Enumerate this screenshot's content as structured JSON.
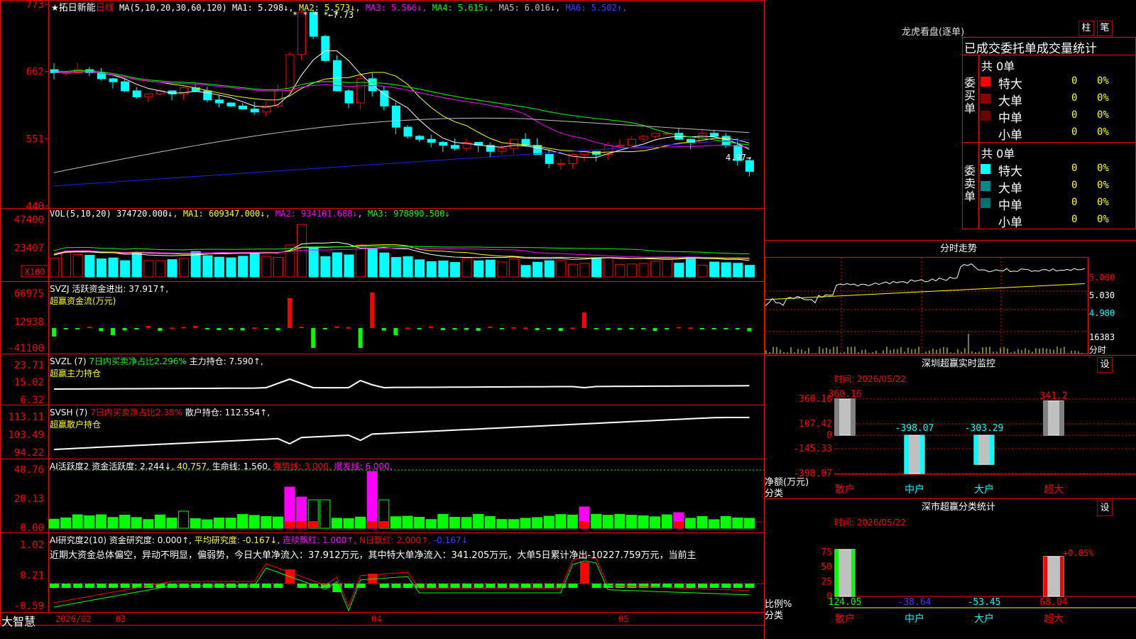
{
  "header": {
    "stock_name": "拓日新能",
    "period": "日线",
    "ma_params": "MA(5,10,20,30,60,120)",
    "ma": [
      {
        "label": "MA1:",
        "value": "5.298↓",
        "color": "#ffffff"
      },
      {
        "label": "MA2:",
        "value": "5.573↓",
        "color": "#ffff00"
      },
      {
        "label": "MA3:",
        "value": "5.566↓",
        "color": "#ff00ff"
      },
      {
        "label": "MA4:",
        "value": "5.615↓",
        "color": "#00ff00"
      },
      {
        "label": "MA5:",
        "value": "6.016↓",
        "color": "#c0c0c0"
      },
      {
        "label": "MA6:",
        "value": "5.502↑",
        "color": "#4040ff"
      }
    ],
    "high_mark": "7.73",
    "low_mark": "4.97",
    "stars": "* * *  *       *"
  },
  "panels": {
    "vol": {
      "label": "VOL(5,10,20)",
      "v": "374720.000↓",
      "ma1": "MA1: 609347.000↓",
      "ma2": "MA2: 934101.688↓",
      "ma3": "MA3: 978890.500↓",
      "unit": "X100"
    },
    "svzj": {
      "label": "SVZJ  活跃资金进出: 37.917↑,",
      "sub": "超赢资金流(万元)"
    },
    "svzl": {
      "label": "SVZL (7)",
      "pct": "7日内买卖净占比2.296%",
      "hold": "主力持仓: 7.590↑,",
      "sub": "超赢主力持仓"
    },
    "svsh": {
      "label": "SVSH (7)",
      "pct": "7日内买卖净占比2.38%",
      "hold": "散户持仓: 112.554↑,",
      "sub": "超赢散户持仓"
    },
    "ai2": {
      "label": "AI活跃度2",
      "fund": "资金活跃度: 2.244↓,",
      "val": "40.757,",
      "life": "生命线: 1.560,",
      "strong": "强势线: 3.000,",
      "burst": "爆发线: 6.000,"
    },
    "ai_research": {
      "label": "AI研究度2(10)",
      "r": "资金研究度: 0.000↑,",
      "avg": "平均研究度: -0.167↓,",
      "c": "连续飘红: 1.000↑,",
      "n": "N日飘红: 2.000↑,",
      "last": "-0.167↓"
    },
    "commentary": "近期大资金总体偏空，异动不明显，偏弱势，今日大单净流入：37.912万元，其中特大单净流入：341.205万元，大单5日累计净出-10227.759万元，当前主"
  },
  "left_axis": {
    "price": [
      "773",
      "662",
      "551",
      "440"
    ],
    "vol": [
      "47400",
      "23407"
    ],
    "svzj": [
      "66975",
      "12938",
      "-41100"
    ],
    "svzl": [
      "23.71",
      "15.02",
      "6.32"
    ],
    "svsh": [
      "113.11",
      "103.49",
      "94.22"
    ],
    "ai2": [
      "40.76",
      "20.13",
      "0.00"
    ],
    "ai_research": [
      "1.02",
      "0.21",
      "-0.59"
    ]
  },
  "date_axis": {
    "months": [
      "2026/02",
      "03",
      "04",
      "05"
    ],
    "brand": "大智慧"
  },
  "right_panel": {
    "title": "龙虎看盘(逐单)",
    "buttons": [
      "柱",
      "笔"
    ],
    "table_header": "已成交委托单成交量统计",
    "buy_section": {
      "side": "委买单",
      "total": "共 0单",
      "rows": [
        {
          "name": "特大",
          "count": "0",
          "pct": "0%",
          "color": "#ff0000"
        },
        {
          "name": "大单",
          "count": "0",
          "pct": "0%",
          "color": "#8b0000"
        },
        {
          "name": "中单",
          "count": "0",
          "pct": "0%",
          "color": "#6b0000"
        },
        {
          "name": "小单",
          "count": "0",
          "pct": "0%",
          "color": "#000000"
        }
      ]
    },
    "sell_section": {
      "side": "委卖单",
      "total": "共 0单",
      "rows": [
        {
          "name": "特大",
          "count": "0",
          "pct": "0%",
          "color": "#00ffff"
        },
        {
          "name": "大单",
          "count": "0",
          "pct": "0%",
          "color": "#008b8b"
        },
        {
          "name": "中单",
          "count": "0",
          "pct": "0%",
          "color": "#007070"
        },
        {
          "name": "小单",
          "count": "0",
          "pct": "0%",
          "color": "#000000"
        }
      ]
    },
    "intraday": {
      "title": "分时走势",
      "p1": "5.080",
      "p2": "5.030",
      "p3": "4.980",
      "v": "16383",
      "unit": "分时"
    },
    "monitor": {
      "title": "深圳超赢实时监控",
      "set": "设",
      "time": "时间: 2026/05/22",
      "y_labels": [
        "360.16",
        "107.42",
        "0",
        "-145.33",
        "-398.07"
      ],
      "ylabel1": "净额(万元)",
      "ylabel2": "分类"
    },
    "classify": {
      "title": "深市超赢分类统计",
      "set": "设",
      "time": "时间: 2026/05/22",
      "y_labels": [
        "75",
        "50",
        "25",
        "0"
      ],
      "ylabel1": "比例%",
      "ylabel2": "分类",
      "pct_note": "+0.05%"
    }
  },
  "chart_data": [
    {
      "type": "candlestick",
      "title": "拓日新能 日线",
      "n_bars": 60,
      "highlights": {
        "high": 7.73,
        "low": 4.97
      },
      "ylim": [
        4.4,
        7.73
      ],
      "ma_lines": [
        "MA1",
        "MA2",
        "MA3",
        "MA4",
        "MA5",
        "MA6"
      ]
    },
    {
      "type": "bar",
      "title": "深圳超赢实时监控",
      "categories": [
        "散户",
        "中户",
        "大户",
        "超大"
      ],
      "values": [
        360.16,
        -398.07,
        -303.29,
        341.2
      ],
      "ylim": [
        -398.07,
        360.16
      ]
    },
    {
      "type": "bar",
      "title": "深市超赢分类统计",
      "categories": [
        "散户",
        "中户",
        "大户",
        "超大"
      ],
      "values": [
        124.05,
        -38.64,
        -53.45,
        68.04
      ],
      "ylim": [
        0,
        75
      ]
    }
  ]
}
